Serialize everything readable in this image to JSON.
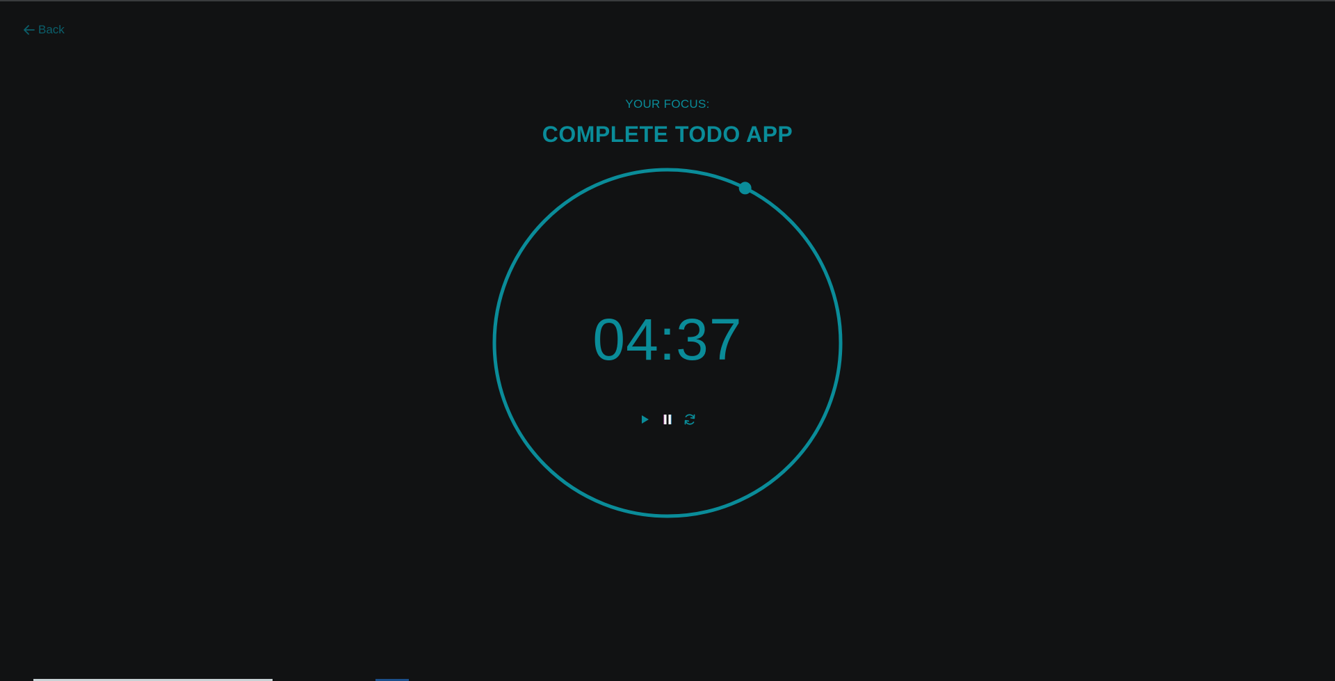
{
  "nav": {
    "back_label": "Back",
    "back_icon": "arrow-left-icon"
  },
  "focus": {
    "label": "YOUR FOCUS:",
    "title": "COMPLETE TODO APP"
  },
  "timer": {
    "display": "04:37",
    "progress_fraction": 0.074
  },
  "controls": {
    "play_icon": "play-icon",
    "pause_icon": "pause-icon",
    "reset_icon": "refresh-icon"
  },
  "colors": {
    "background": "#111213",
    "accent": "#0a8c99",
    "back_link": "#0b5f6b",
    "pause_active": "#ffffff"
  }
}
